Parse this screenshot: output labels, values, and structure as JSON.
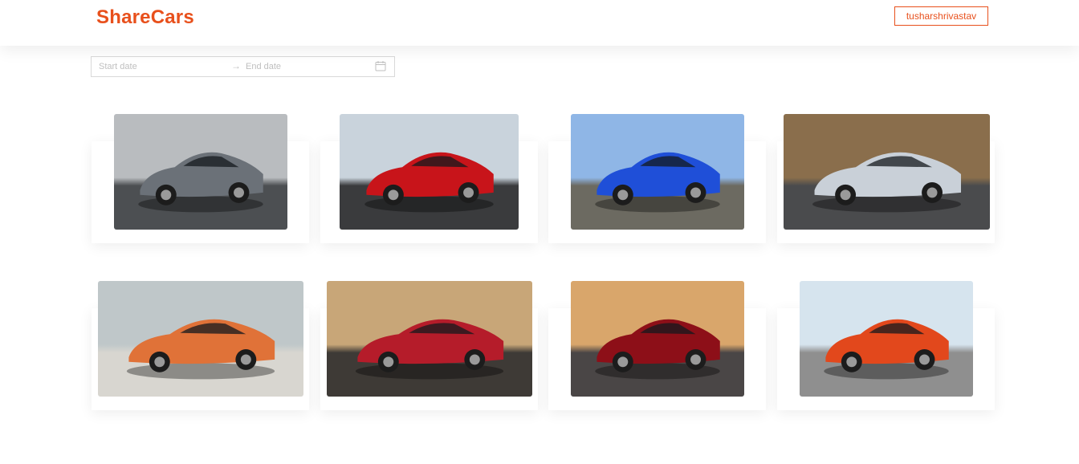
{
  "header": {
    "brand": "ShareCars",
    "user_button": "tusharshrivastav"
  },
  "date_range": {
    "start_placeholder": "Start date",
    "end_placeholder": "End date",
    "separator": "→"
  },
  "cars": [
    {
      "name": "car-photo-grey-hypercar",
      "body_color": "#6b7178",
      "bg_top": "#b9bcbf",
      "bg_bottom": "#4c4f52"
    },
    {
      "name": "car-photo-red-ferrari",
      "body_color": "#c8141a",
      "bg_top": "#c9d3dc",
      "bg_bottom": "#3a3b3d"
    },
    {
      "name": "car-photo-blue-lamborghini",
      "body_color": "#1f4fd8",
      "bg_top": "#8fb6e6",
      "bg_bottom": "#6c6a61"
    },
    {
      "name": "car-photo-silver-bmw-i8",
      "body_color": "#c9d0d8",
      "bg_top": "#8a6e4c",
      "bg_bottom": "#4a4b4d"
    },
    {
      "name": "car-photo-orange-mercedes",
      "body_color": "#e07238",
      "bg_top": "#bfc7c9",
      "bg_bottom": "#d8d6d0"
    },
    {
      "name": "car-photo-red-tesla-roadster",
      "body_color": "#b51c2a",
      "bg_top": "#c8a678",
      "bg_bottom": "#3e3a36"
    },
    {
      "name": "car-photo-red-nissan-gtr",
      "body_color": "#8d0f18",
      "bg_top": "#d9a66b",
      "bg_bottom": "#4a4646"
    },
    {
      "name": "car-photo-orange-mclaren-p1",
      "body_color": "#e2481c",
      "bg_top": "#d6e4ee",
      "bg_bottom": "#8f8f8f"
    }
  ]
}
